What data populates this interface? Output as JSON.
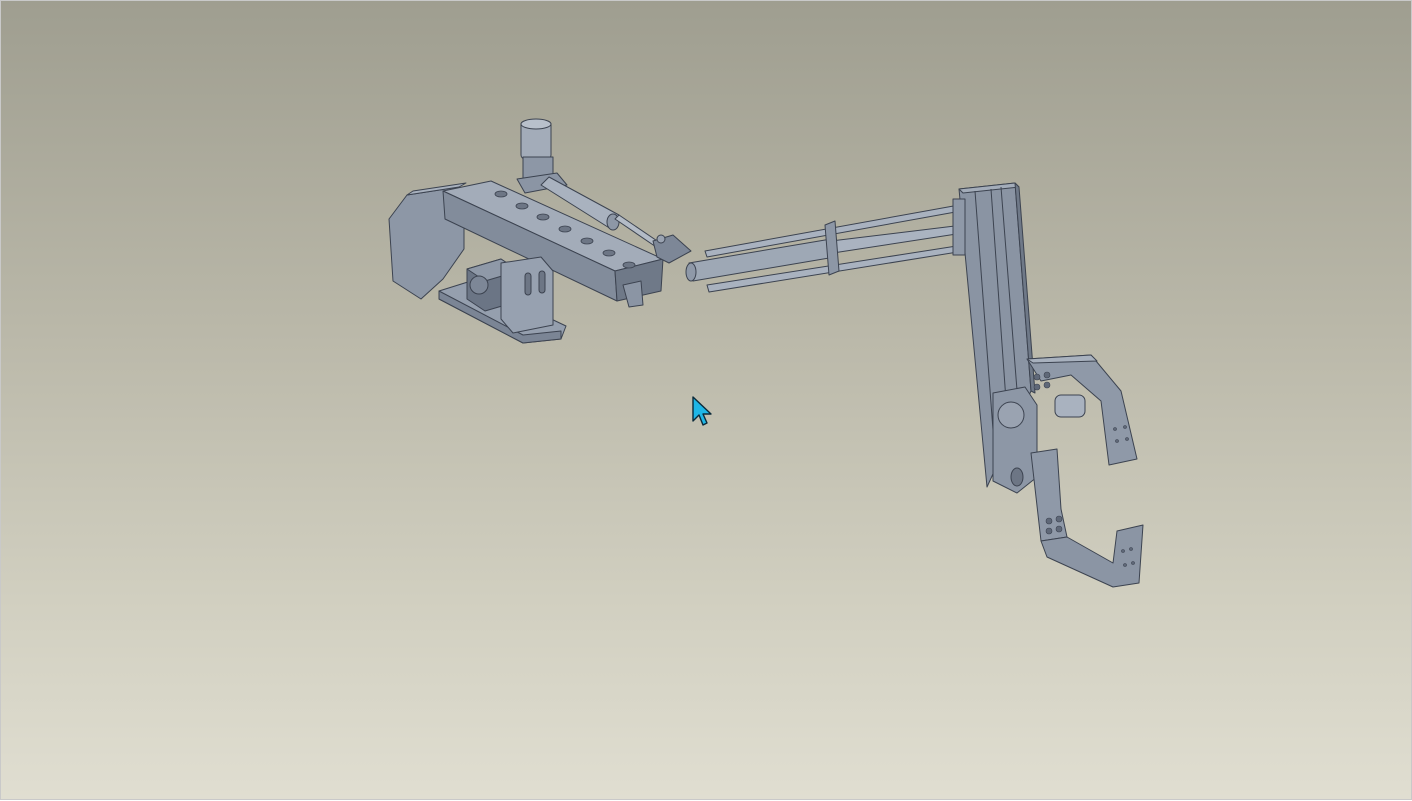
{
  "viewport": {
    "background_top": "#9f9e90",
    "background_bottom": "#e0ded1"
  },
  "model": {
    "part_fill": "#8f99a8",
    "part_fill_light": "#a9b2bf",
    "part_fill_dark": "#717b8a",
    "edge_color": "#3c4350"
  },
  "cursor": {
    "icon": "arrow-pointer-icon",
    "color": "#1fb6e6"
  }
}
